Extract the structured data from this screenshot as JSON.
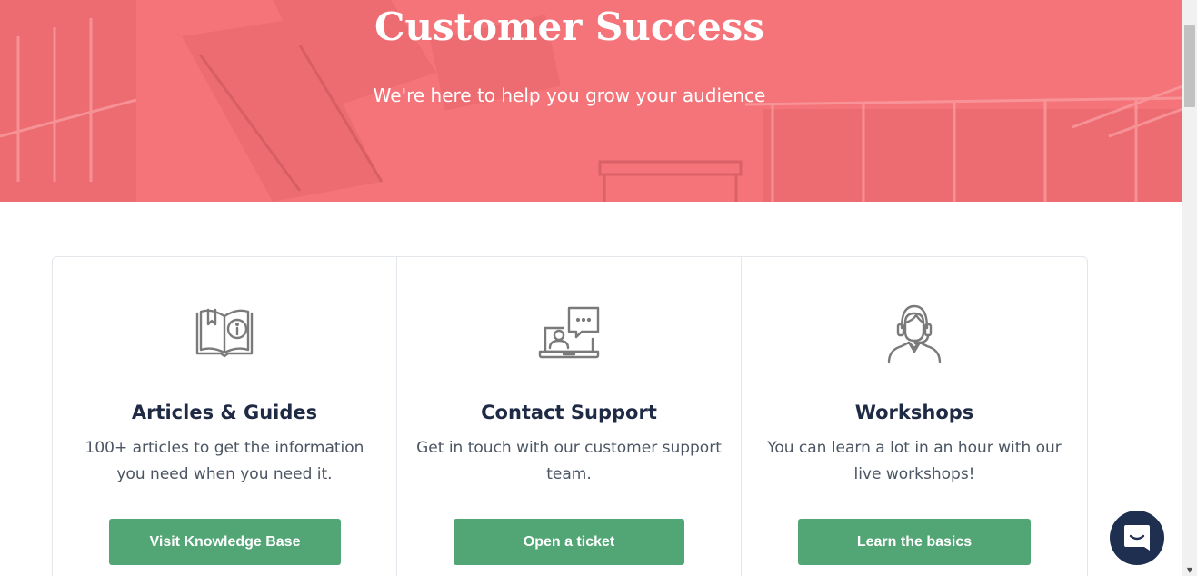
{
  "hero": {
    "title": "Customer Success",
    "subtitle": "We're here to help you grow your audience",
    "background_color": "#f47479"
  },
  "cards": [
    {
      "icon": "book-info-icon",
      "title": "Articles & Guides",
      "description": "100+ articles to get the information you need when you need it.",
      "button_label": "Visit Knowledge Base"
    },
    {
      "icon": "laptop-chat-icon",
      "title": "Contact Support",
      "description": "Get in touch with our customer support team.",
      "button_label": "Open a ticket"
    },
    {
      "icon": "headset-agent-icon",
      "title": "Workshops",
      "description": "You can learn a lot in an hour with our live workshops!",
      "button_label": "Learn the basics"
    }
  ],
  "colors": {
    "button": "#52a574",
    "heading": "#1f2a44",
    "chat_launcher": "#1f2f4f"
  },
  "chat": {
    "icon": "chat-icon"
  }
}
